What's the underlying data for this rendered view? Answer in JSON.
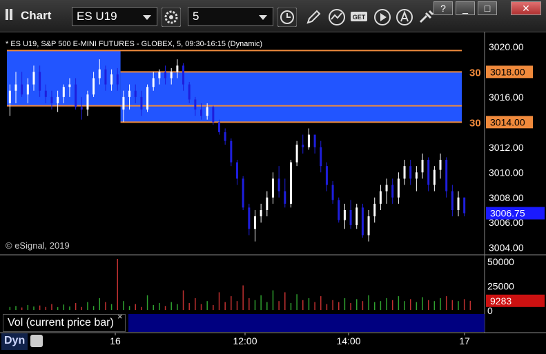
{
  "window": {
    "title": "Chart"
  },
  "toolbar": {
    "symbol_value": "ES U19",
    "interval_value": "5",
    "buttons": [
      "gear-icon",
      "clock-icon",
      "pencil-icon",
      "line-tool-icon",
      "get-icon",
      "play-icon",
      "alert-icon",
      "tools-icon"
    ],
    "window_buttons": {
      "help": "?",
      "minimize": "_",
      "maximize": "□",
      "close": "✕"
    }
  },
  "chart": {
    "info_label": "* ES U19, S&P 500 E-MINI FUTURES - GLOBEX, 5, 09:30-16:15 (Dynamic)",
    "watermark": "© eSignal, 2019",
    "price_axis_labels": [
      "3020.00",
      "3018.00",
      "3016.00",
      "3014.00",
      "3012.00",
      "3010.00",
      "3008.00",
      "3006.00",
      "3004.00"
    ],
    "level_tags": [
      {
        "badge": "30",
        "price": "3018.00"
      },
      {
        "badge": "30",
        "price": "3014.00"
      }
    ],
    "current_price": "3006.75",
    "time_axis_labels": [
      "16",
      "12:00",
      "14:00",
      "17"
    ],
    "volume_axis_labels": [
      "50000",
      "25000",
      "0"
    ],
    "current_volume": "9283",
    "volume_study_label": "Vol (current price bar)",
    "volume_study_close": "×",
    "status": "Dyn",
    "colors": {
      "up": "#ffffff",
      "down": "#1e1edc",
      "highlight": "#2255ff",
      "level_line": "#f08a3c",
      "vol_up": "#2fa12f",
      "vol_down": "#c03030"
    }
  },
  "chart_data": {
    "type": "candlestick",
    "ylim": [
      3003.6,
      3021.2
    ],
    "price_bars": [
      [
        3015.5,
        3017,
        3014.5,
        3016.5
      ],
      [
        3016.5,
        3018,
        3015.5,
        3017
      ],
      [
        3017,
        3018,
        3016,
        3016.2
      ],
      [
        3016.2,
        3017.5,
        3015.5,
        3017
      ],
      [
        3017,
        3018.5,
        3016.5,
        3018
      ],
      [
        3018,
        3018.5,
        3016,
        3016.5
      ],
      [
        3016.5,
        3017,
        3015.5,
        3016
      ],
      [
        3016,
        3016.5,
        3015,
        3015.5
      ],
      [
        3015.5,
        3016.5,
        3014.8,
        3016
      ],
      [
        3016,
        3017,
        3015.5,
        3016.8
      ],
      [
        3016.8,
        3017.5,
        3016,
        3017
      ],
      [
        3017,
        3017.5,
        3015,
        3015.2
      ],
      [
        3015.2,
        3016,
        3014.2,
        3015
      ],
      [
        3015,
        3016.5,
        3014.5,
        3016.2
      ],
      [
        3016.2,
        3018,
        3016,
        3017.5
      ],
      [
        3017.5,
        3019,
        3017,
        3018.2
      ],
      [
        3018.2,
        3018.5,
        3016.5,
        3017
      ],
      [
        3017,
        3018.2,
        3016.5,
        3017.8
      ],
      [
        3017.8,
        3018.3,
        3016.5,
        3017
      ],
      [
        3015,
        3016.5,
        3014,
        3016
      ],
      [
        3016,
        3017,
        3015,
        3016.5
      ],
      [
        3016.5,
        3017,
        3015.5,
        3016
      ],
      [
        3016,
        3016.5,
        3014.5,
        3015
      ],
      [
        3015,
        3017,
        3014.8,
        3016.8
      ],
      [
        3016.8,
        3018,
        3016.5,
        3017.5
      ],
      [
        3017.5,
        3018.2,
        3017,
        3018
      ],
      [
        3018,
        3018.5,
        3017,
        3017.5
      ],
      [
        3017.5,
        3018.3,
        3017,
        3018
      ],
      [
        3018,
        3019,
        3017.5,
        3018.5
      ],
      [
        3018.5,
        3018.7,
        3016.5,
        3017
      ],
      [
        3017,
        3017.2,
        3015.5,
        3015.8
      ],
      [
        3015.8,
        3016,
        3014.5,
        3015
      ],
      [
        3015,
        3015.5,
        3014.2,
        3014.5
      ],
      [
        3014.5,
        3015.5,
        3014.2,
        3015.2
      ],
      [
        3015.2,
        3015.3,
        3013.8,
        3014
      ],
      [
        3014,
        3014.2,
        3013,
        3013.2
      ],
      [
        3013.2,
        3013.5,
        3012.2,
        3012.5
      ],
      [
        3012.5,
        3012.7,
        3010.5,
        3010.8
      ],
      [
        3010.8,
        3011,
        3009,
        3009.5
      ],
      [
        3009.5,
        3009.7,
        3007,
        3007.2
      ],
      [
        3007.2,
        3007.5,
        3005,
        3005.5
      ],
      [
        3005.5,
        3007,
        3004.5,
        3006.5
      ],
      [
        3006.5,
        3007.5,
        3006,
        3007
      ],
      [
        3007,
        3008.5,
        3006.5,
        3008
      ],
      [
        3008,
        3010,
        3007.5,
        3009.5
      ],
      [
        3009.5,
        3010.5,
        3008,
        3008.5
      ],
      [
        3008.5,
        3009.5,
        3007.2,
        3007.5
      ],
      [
        3007.5,
        3011,
        3007.2,
        3010.8
      ],
      [
        3010.8,
        3012.5,
        3010.5,
        3012.2
      ],
      [
        3012.2,
        3013,
        3011.5,
        3012
      ],
      [
        3012,
        3013.5,
        3011.8,
        3013
      ],
      [
        3013,
        3013,
        3011.5,
        3012
      ],
      [
        3012,
        3012.5,
        3010,
        3010.5
      ],
      [
        3010.5,
        3010.8,
        3008.5,
        3009
      ],
      [
        3009,
        3009.3,
        3007.5,
        3007.8
      ],
      [
        3007.8,
        3008,
        3006,
        3006.2
      ],
      [
        3006.2,
        3007.5,
        3005.5,
        3007
      ],
      [
        3007,
        3007.8,
        3005.5,
        3005.8
      ],
      [
        3005.8,
        3007.5,
        3005.5,
        3007.2
      ],
      [
        3007.2,
        3007.5,
        3004.8,
        3005
      ],
      [
        3005,
        3007,
        3004.5,
        3006.5
      ],
      [
        3006.5,
        3008,
        3006,
        3007.5
      ],
      [
        3007.5,
        3009,
        3007,
        3008.5
      ],
      [
        3008.5,
        3009.5,
        3007.5,
        3009
      ],
      [
        3009,
        3009.5,
        3007.5,
        3008
      ],
      [
        3008,
        3010,
        3007.5,
        3009.5
      ],
      [
        3009.5,
        3011,
        3009,
        3010.5
      ],
      [
        3010.5,
        3011,
        3009,
        3009.5
      ],
      [
        3009.5,
        3010.5,
        3008.5,
        3010
      ],
      [
        3010,
        3011.5,
        3009.5,
        3011
      ],
      [
        3011,
        3011.2,
        3008.5,
        3009
      ],
      [
        3009,
        3010.5,
        3008.5,
        3010.2
      ],
      [
        3010.2,
        3011.5,
        3009.5,
        3011
      ],
      [
        3011,
        3011.2,
        3008,
        3008.5
      ],
      [
        3008.5,
        3009,
        3006.5,
        3007
      ],
      [
        3007,
        3008.5,
        3006.5,
        3008
      ],
      [
        3008,
        3008,
        3006.5,
        3006.75
      ]
    ],
    "highlight_zones": [
      {
        "from_bar": 0,
        "to_bar": 18,
        "top": 3019.7,
        "bottom": 3015.3
      },
      {
        "from_bar": 19,
        "to_bar": 83,
        "top": 3018,
        "bottom": 3014
      }
    ],
    "volume_bars": [
      3000,
      4000,
      2500,
      5000,
      3500,
      4500,
      3000,
      6000,
      2800,
      5500,
      3500,
      7000,
      3000,
      8000,
      4000,
      12000,
      8000,
      6000,
      52000,
      9000,
      4000,
      6000,
      3000,
      15000,
      5000,
      7000,
      4000,
      8000,
      6000,
      20000,
      7000,
      12000,
      6000,
      9000,
      5000,
      18000,
      8000,
      14000,
      9000,
      25000,
      12000,
      10000,
      15000,
      8000,
      20000,
      9000,
      18000,
      7000,
      16000,
      10000,
      12000,
      8000,
      14000,
      6000,
      10000,
      8000,
      12000,
      7000,
      11000,
      9000,
      15000,
      8000,
      9000,
      12000,
      10000,
      14000,
      9000,
      11000,
      8000,
      13000,
      10000,
      9000,
      12000,
      14000,
      10000,
      9000,
      11000,
      9283
    ],
    "volume_ylim": [
      0,
      52000
    ],
    "x_ticks": [
      "16",
      "12:00",
      "14:00",
      "17"
    ]
  }
}
